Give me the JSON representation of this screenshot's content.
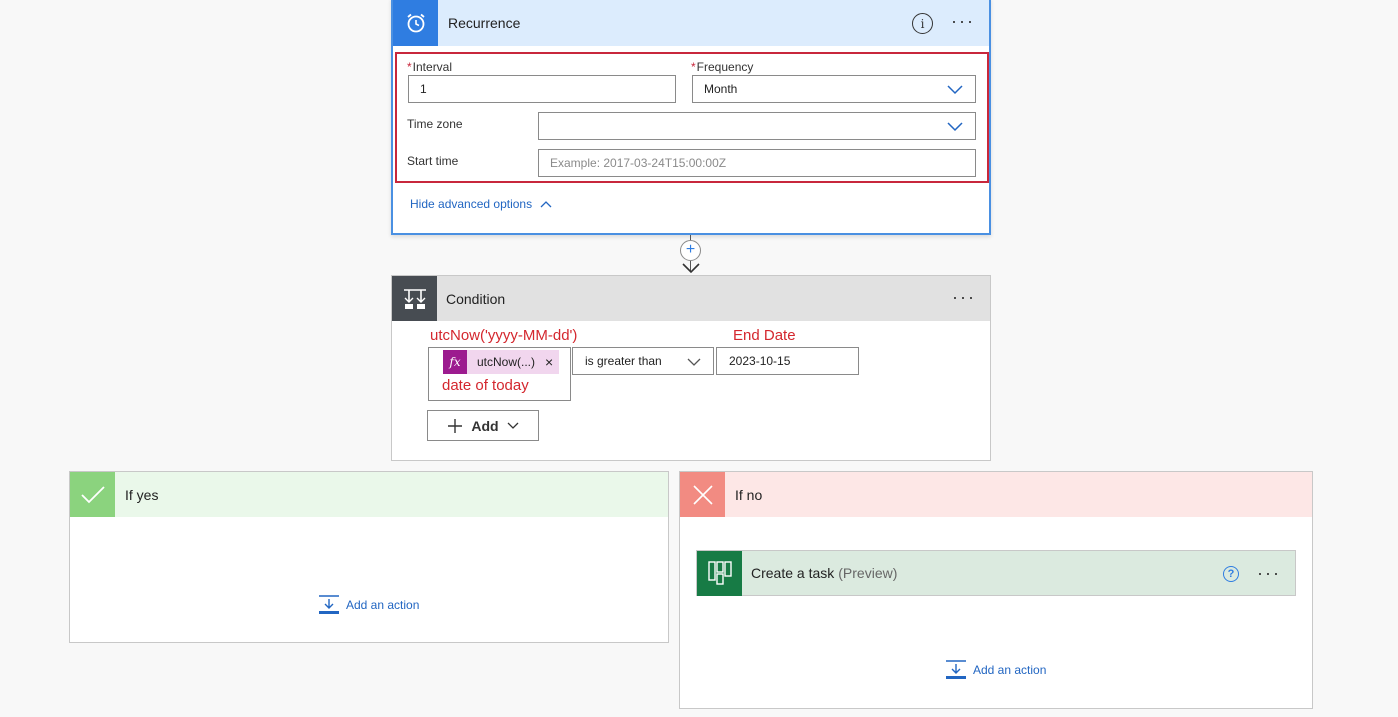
{
  "recurrence": {
    "title": "Recurrence",
    "info_label": "i",
    "more_label": "···",
    "interval": {
      "label": "Interval",
      "required_mark": "*",
      "value": "1"
    },
    "frequency": {
      "label": "Frequency",
      "required_mark": "*",
      "value": "Month"
    },
    "time_zone": {
      "label": "Time zone",
      "value": ""
    },
    "start_time": {
      "label": "Start time",
      "placeholder": "Example: 2017-03-24T15:00:00Z"
    },
    "hide_advanced": "Hide advanced options"
  },
  "connector": {
    "plus_label": "+"
  },
  "condition": {
    "title": "Condition",
    "more_label": "···",
    "annotation_expression": "utcNow('yyyy-MM-dd')",
    "annotation_value": "End Date",
    "annotation_today": "date of today",
    "token_fx": "fx",
    "token_text": "utcNow(...)",
    "token_remove": "×",
    "operator": "is greater than",
    "value": "2023-10-15",
    "add_label": "Add"
  },
  "if_yes": {
    "title": "If yes",
    "add_action": "Add an action"
  },
  "if_no": {
    "title": "If no",
    "task": {
      "title": "Create a task",
      "preview": "(Preview)",
      "help_label": "?",
      "more_label": "···"
    },
    "add_action": "Add an action"
  },
  "colors": {
    "accent_blue": "#2f7de1",
    "error_red": "#c8273c",
    "yes_green": "#8bd37e",
    "no_red": "#f28b82",
    "planner_green": "#177b45",
    "expression_purple": "#9c1b8f"
  }
}
